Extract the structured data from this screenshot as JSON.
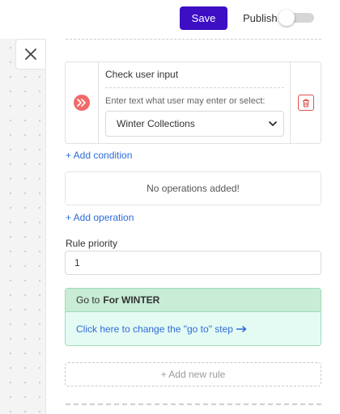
{
  "toolbar": {
    "save_label": "Save",
    "publish_label": "Publish",
    "publish_enabled": false
  },
  "icons": {
    "close": "close-icon",
    "condition": "fast-forward-icon",
    "delete": "trash-icon",
    "select_chevron": "chevron-down-icon",
    "goto_arrow": "arrow-right-icon"
  },
  "condition": {
    "title": "Check user input",
    "hint": "Enter text what user may enter or select:",
    "selected_value": "Winter Collections"
  },
  "links": {
    "add_condition": "+ Add condition",
    "add_operation": "+ Add operation"
  },
  "operations": {
    "empty_text": "No operations added!"
  },
  "priority": {
    "label": "Rule priority",
    "value": "1"
  },
  "goto": {
    "prefix": "Go to",
    "target": "For WINTER",
    "change_link": "Click here to change the \"go to\" step"
  },
  "add_rule_label": "+ Add new rule",
  "colors": {
    "save_button": "#3d0ec4",
    "link": "#2e6bd8",
    "condition_icon": "#f06a6a",
    "delete_icon": "#e05252",
    "goto_header": "#c8ecd6",
    "goto_body": "#e4fbf4"
  }
}
